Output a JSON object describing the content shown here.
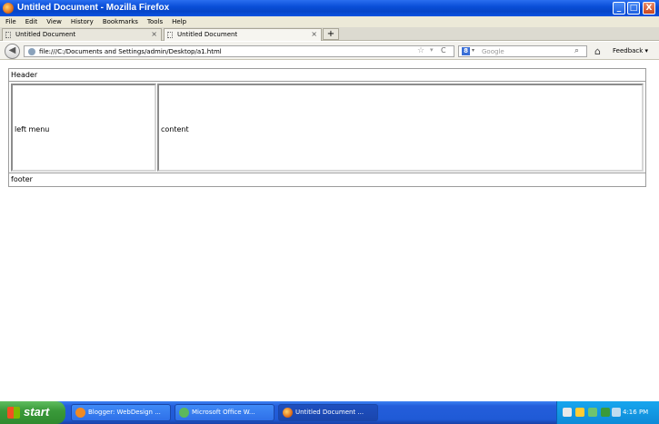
{
  "window": {
    "title": "Untitled Document - Mozilla Firefox",
    "minimize": "_",
    "maximize": "□",
    "close": "X"
  },
  "menu": [
    "File",
    "Edit",
    "View",
    "History",
    "Bookmarks",
    "Tools",
    "Help"
  ],
  "tabs": [
    {
      "label": "Untitled Document",
      "close": "×"
    },
    {
      "label": "Untitled Document",
      "close": "×"
    }
  ],
  "newtab_label": "+",
  "nav": {
    "back": "◀",
    "url": "file:///C:/Documents and Settings/admin/Desktop/a1.html",
    "star": "☆",
    "dropdown": "▾",
    "reload": "C",
    "search_engine": "8",
    "search_dropdown": "▾",
    "search_placeholder": "Google",
    "search_button": "⌕",
    "home": "⌂",
    "feedback": "Feedback ▾"
  },
  "page": {
    "header": "Header",
    "left_menu": "left menu",
    "content": "content",
    "footer": "footer"
  },
  "taskbar": {
    "start": "start",
    "items": [
      {
        "label": "Blogger: WebDesign ..."
      },
      {
        "label": "Microsoft Office W..."
      },
      {
        "label": "Untitled Document ..."
      }
    ],
    "clock": "4:16 PM"
  },
  "colors": {
    "titlebar": "#0a4fd8",
    "taskbar": "#245edb",
    "start": "#3a9a3a"
  }
}
